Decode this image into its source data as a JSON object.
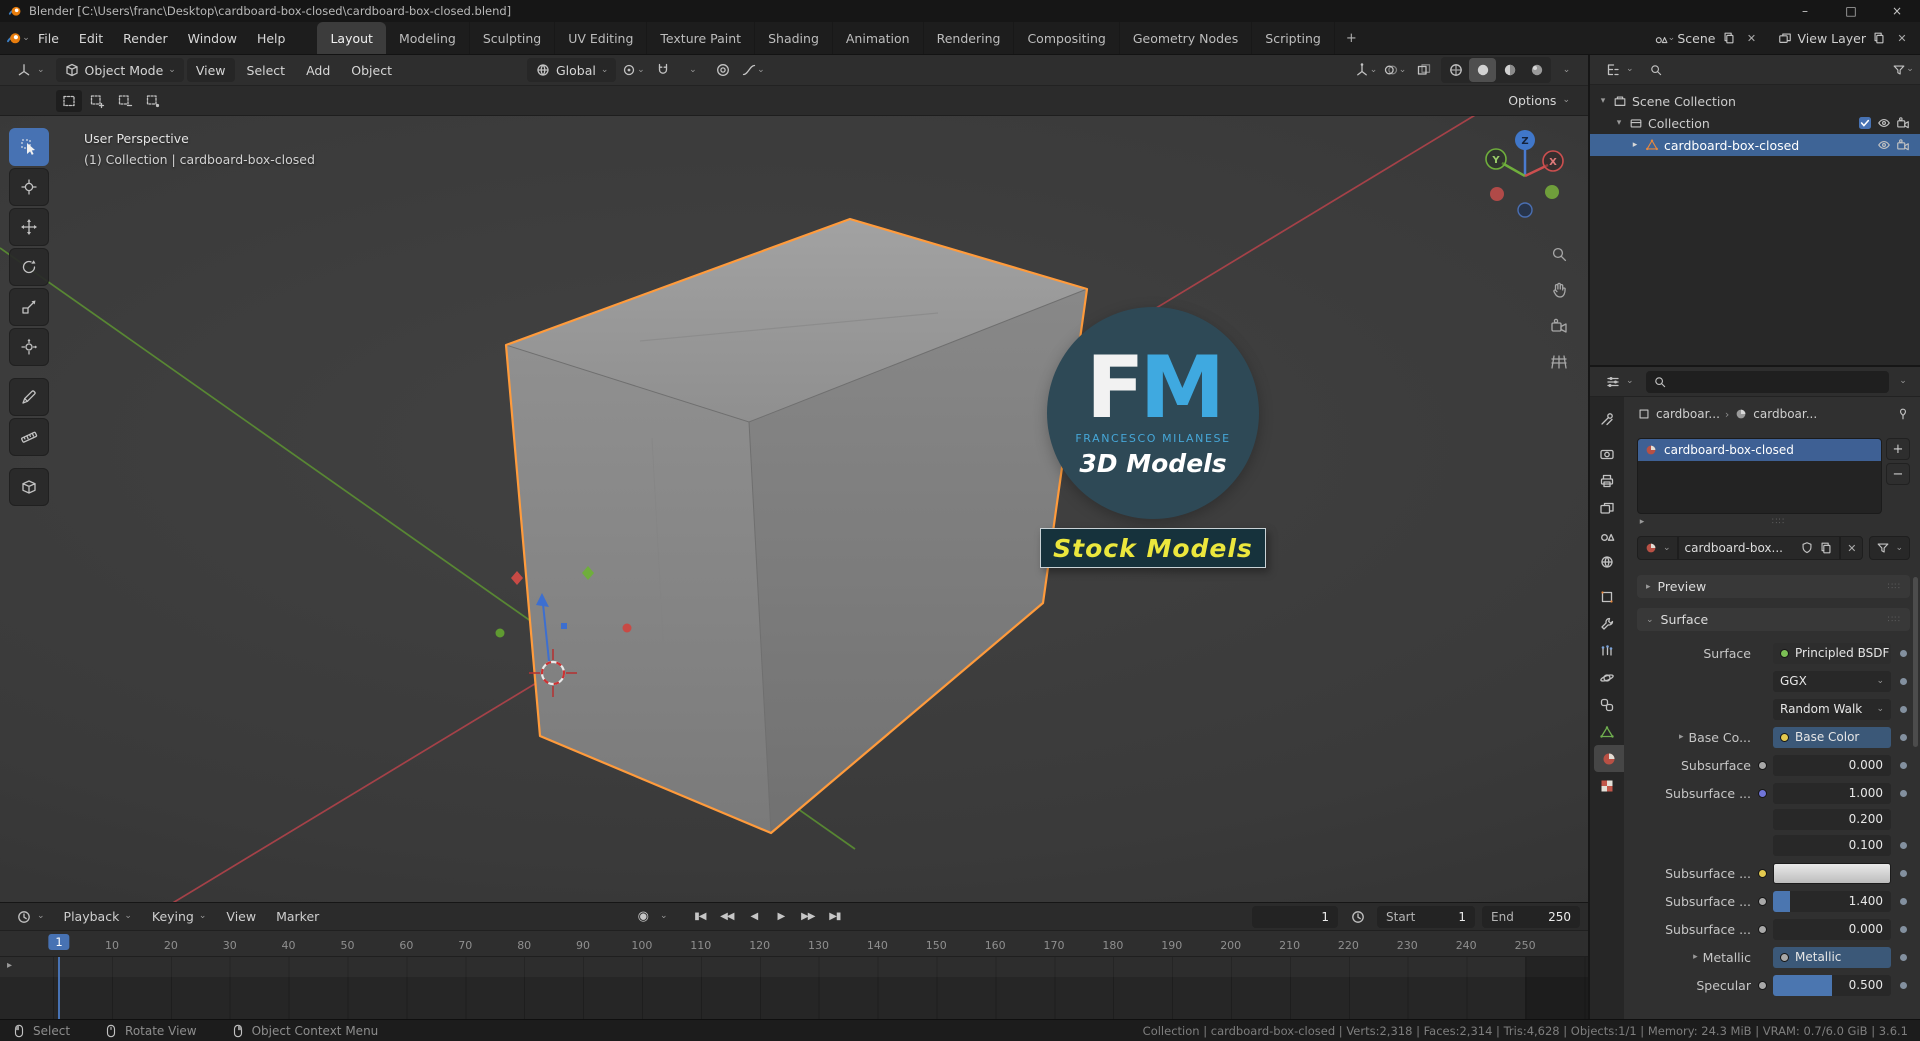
{
  "window": {
    "title": "Blender [C:\\Users\\franc\\Desktop\\cardboard-box-closed\\cardboard-box-closed.blend]",
    "minimize": "–",
    "maximize": "□",
    "close": "×"
  },
  "icons": {
    "chevron_down": "⌄",
    "chevron_right": "▸",
    "chevron_exp": "▾",
    "crumb_sep": "›",
    "plus": "+",
    "minus": "−",
    "close": "✕",
    "grip": "∷∷",
    "record": "◉",
    "jump_start": "▮◀",
    "prev_key": "◀◀",
    "play_back": "◀",
    "play": "▶",
    "next_key": "▶▶",
    "jump_end": "▶▮"
  },
  "topbar": {
    "menus": [
      "File",
      "Edit",
      "Render",
      "Window",
      "Help"
    ],
    "workspaces": [
      "Layout",
      "Modeling",
      "Sculpting",
      "UV Editing",
      "Texture Paint",
      "Shading",
      "Animation",
      "Rendering",
      "Compositing",
      "Geometry Nodes",
      "Scripting"
    ],
    "add_tab": "+",
    "scene_label": "Scene",
    "view_layer_label": "View Layer"
  },
  "vheader": {
    "mode": "Object Mode",
    "menu_view": "View",
    "menu_select": "Select",
    "menu_add": "Add",
    "menu_object": "Object",
    "orientation": "Global"
  },
  "toolbar_options": "Options",
  "viewport": {
    "line1": "User Perspective",
    "line2": "(1) Collection | cardboard-box-closed",
    "axis_x": "X",
    "axis_y": "Y",
    "axis_z": "Z"
  },
  "watermark": {
    "f": "F",
    "m": "M",
    "subtitle": "FRANCESCO MILANESE",
    "line2": "3D Models",
    "banner": "Stock Models"
  },
  "outliner": {
    "scene_collection": "Scene Collection",
    "collection": "Collection",
    "object": "cardboard-box-closed"
  },
  "properties": {
    "crumb1": "cardboar...",
    "crumb2": "cardboar...",
    "slot_object": "cardboard-box-closed",
    "material_field": "cardboard-box...",
    "preview": "Preview",
    "surface": "Surface",
    "rows": {
      "surface": {
        "label": "Surface",
        "value": "Principled BSDF"
      },
      "distribution": {
        "value": "GGX"
      },
      "subsurface_method": {
        "value": "Random Walk"
      },
      "base_color": {
        "label": "Base Co...",
        "value": "Base Color"
      },
      "subsurface": {
        "label": "Subsurface",
        "value": "0.000"
      },
      "ss_radius_x": {
        "label": "Subsurface ...",
        "value": "1.000"
      },
      "ss_radius_y": {
        "value": "0.200"
      },
      "ss_radius_z": {
        "value": "0.100"
      },
      "ss_color": {
        "label": "Subsurface ..."
      },
      "ss_ior": {
        "label": "Subsurface ...",
        "value": "1.400"
      },
      "ss_aniso": {
        "label": "Subsurface ...",
        "value": "0.000"
      },
      "metallic": {
        "label": "Metallic",
        "value": "Metallic"
      },
      "specular": {
        "label": "Specular",
        "value": "0.500"
      }
    }
  },
  "timeline": {
    "menus": [
      "Playback",
      "Keying",
      "View",
      "Marker"
    ],
    "frame_current": "1",
    "start_label": "Start",
    "start_value": "1",
    "end_label": "End",
    "end_value": "250",
    "playhead": "1",
    "ruler": [
      "10",
      "20",
      "30",
      "40",
      "50",
      "60",
      "70",
      "80",
      "90",
      "100",
      "110",
      "120",
      "130",
      "140",
      "150",
      "160",
      "170",
      "180",
      "190",
      "200",
      "210",
      "220",
      "230",
      "240",
      "250"
    ]
  },
  "statusbar": {
    "item1": "Select",
    "item2": "Rotate View",
    "item3": "Object Context Menu",
    "stats": "Collection | cardboard-box-closed | Verts:2,318 | Faces:2,314 | Tris:4,628 | Objects:1/1 | Memory: 24.3 MiB | VRAM: 0.7/6.0 GiB | 3.6.1"
  }
}
